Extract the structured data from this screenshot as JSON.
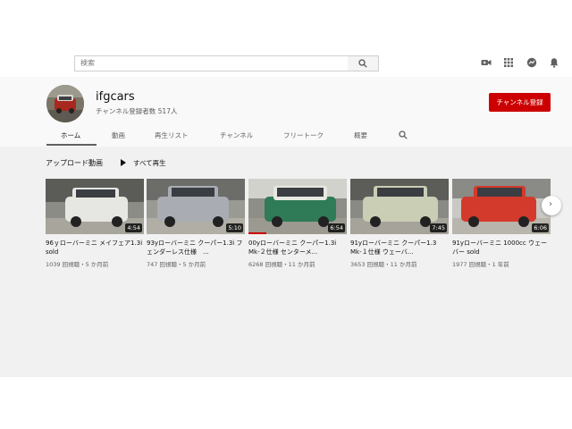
{
  "search": {
    "placeholder": "検索"
  },
  "topbar_icons": [
    "video-camera-icon",
    "apps-grid-icon",
    "messages-icon",
    "bell-icon"
  ],
  "channel": {
    "name": "ifgcars",
    "subscribers": "チャンネル登録者数 517人",
    "subscribe_label": "チャンネル登録"
  },
  "tabs": [
    {
      "label": "ホーム",
      "active": true
    },
    {
      "label": "動画"
    },
    {
      "label": "再生リスト"
    },
    {
      "label": "チャンネル"
    },
    {
      "label": "フリートーク"
    },
    {
      "label": "概要"
    }
  ],
  "section": {
    "title": "アップロード動画",
    "play_all": "すべて再生"
  },
  "videos": [
    {
      "title": "96ｙローバーミニ メイフェア1.3i　sold",
      "views": "1039 回視聴・5 か月前",
      "duration": "4:54",
      "car_color": "#e6e6e2"
    },
    {
      "title": "93yローバーミニ クーパー1.3i フェンダーレス仕様　...",
      "views": "747 回視聴・5 か月前",
      "duration": "5:10",
      "car_color": "#a9adb3"
    },
    {
      "title": "00yローバーミニ クーパー1.3i Mk-２仕様 センターメ...",
      "views": "6268 回視聴・11 か月前",
      "duration": "6:54",
      "car_color": "#2f7a57"
    },
    {
      "title": "91yローバーミニ クーパー1.3　Mk-１仕様 ウェーバ...",
      "views": "3653 回視聴・11 か月前",
      "duration": "7:45",
      "car_color": "#c9ceb5"
    },
    {
      "title": "91yローバーミニ 1000cc ウェーバー sold",
      "views": "1977 回視聴・1 年前",
      "duration": "6:06",
      "car_color": "#d33a2c"
    }
  ],
  "next_arrow": "›"
}
